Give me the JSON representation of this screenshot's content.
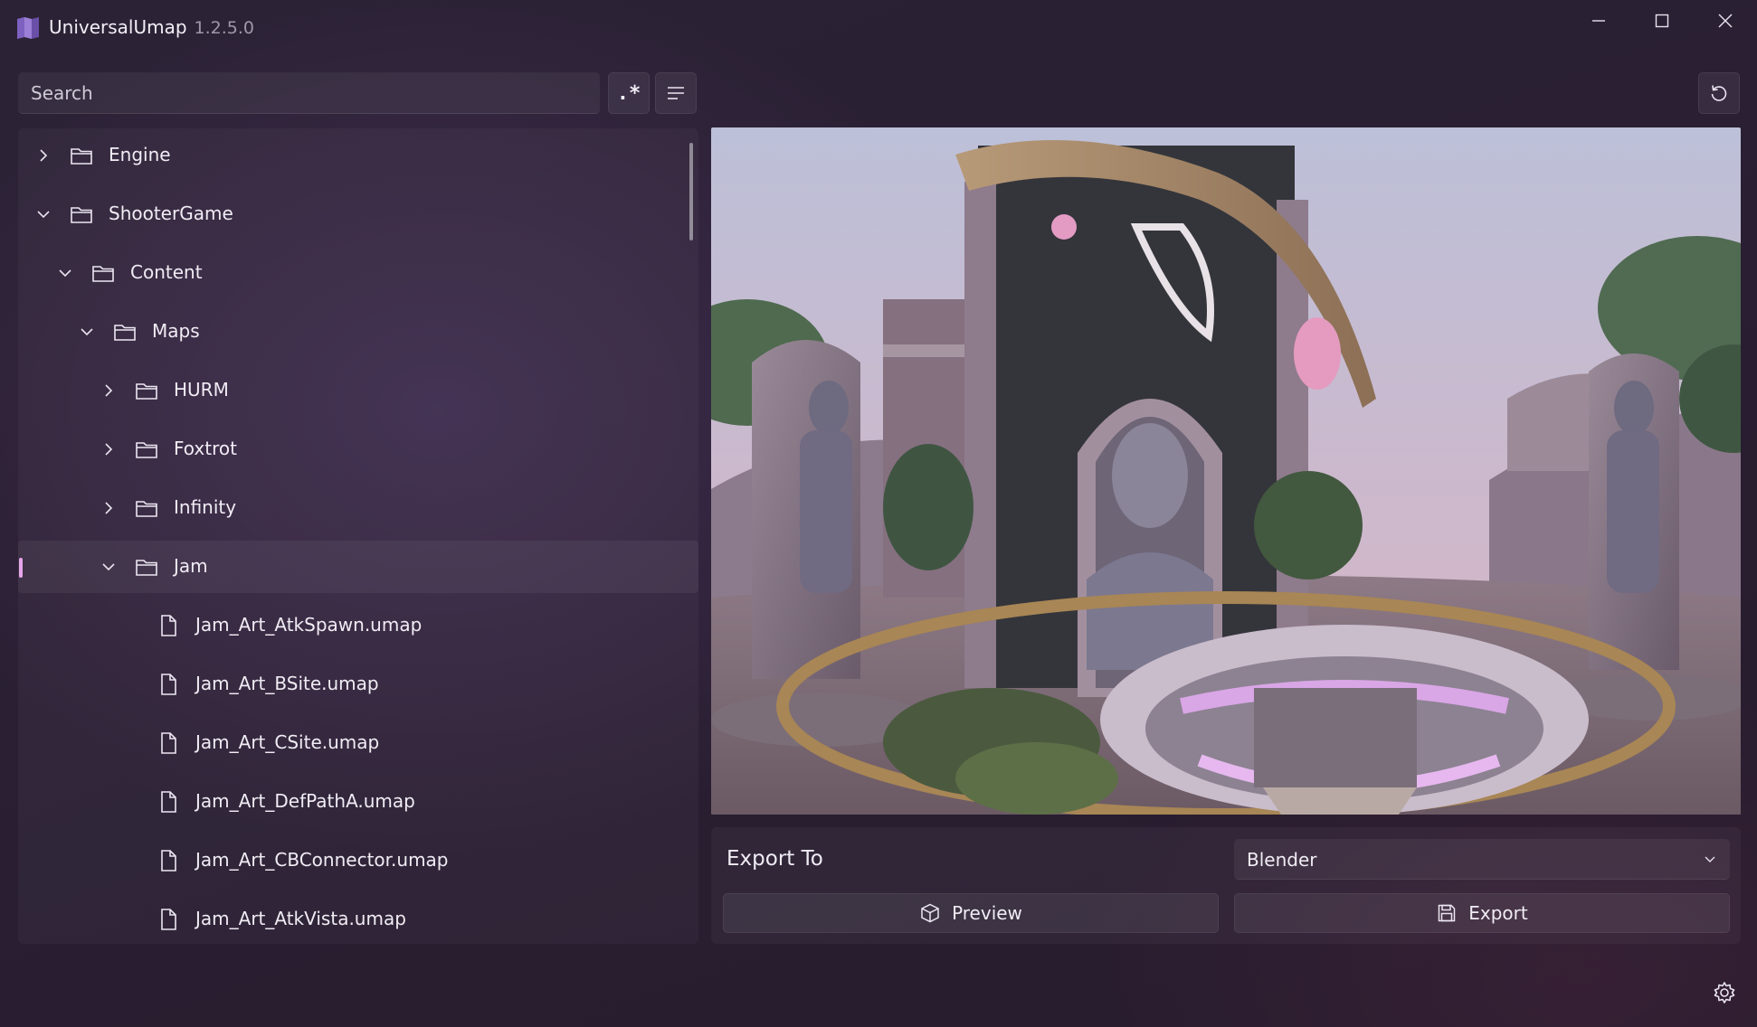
{
  "titlebar": {
    "app_name": "UniversalUmap",
    "version": "1.2.5.0"
  },
  "search": {
    "placeholder": "Search",
    "value": "",
    "regex_label": ".*"
  },
  "tree": [
    {
      "label": "Engine",
      "type": "folder",
      "level": 0,
      "expanded": false
    },
    {
      "label": "ShooterGame",
      "type": "folder",
      "level": 0,
      "expanded": true
    },
    {
      "label": "Content",
      "type": "folder",
      "level": 1,
      "expanded": true
    },
    {
      "label": "Maps",
      "type": "folder",
      "level": 2,
      "expanded": true
    },
    {
      "label": "HURM",
      "type": "folder",
      "level": 3,
      "expanded": false
    },
    {
      "label": "Foxtrot",
      "type": "folder",
      "level": 3,
      "expanded": false
    },
    {
      "label": "Infinity",
      "type": "folder",
      "level": 3,
      "expanded": false
    },
    {
      "label": "Jam",
      "type": "folder",
      "level": 3,
      "expanded": true,
      "selected": true
    },
    {
      "label": "Jam_Art_AtkSpawn.umap",
      "type": "file",
      "level": 4
    },
    {
      "label": "Jam_Art_BSite.umap",
      "type": "file",
      "level": 4
    },
    {
      "label": "Jam_Art_CSite.umap",
      "type": "file",
      "level": 4
    },
    {
      "label": "Jam_Art_DefPathA.umap",
      "type": "file",
      "level": 4
    },
    {
      "label": "Jam_Art_CBConnector.umap",
      "type": "file",
      "level": 4
    },
    {
      "label": "Jam_Art_AtkVista.umap",
      "type": "file",
      "level": 4
    }
  ],
  "export": {
    "label": "Export To",
    "selected_target": "Blender",
    "preview_label": "Preview",
    "export_label": "Export"
  },
  "icons": {
    "app": "map-book-icon",
    "folder": "folder-icon",
    "file": "file-icon",
    "minimize": "minimize-icon",
    "maximize": "maximize-icon",
    "close": "close-icon",
    "menu": "hamburger-menu-icon",
    "refresh": "refresh-icon",
    "settings": "gear-icon",
    "preview": "cube-icon",
    "export": "save-icon"
  },
  "colors": {
    "accent": "#e7a6ea",
    "text": "#f0ecf4"
  }
}
